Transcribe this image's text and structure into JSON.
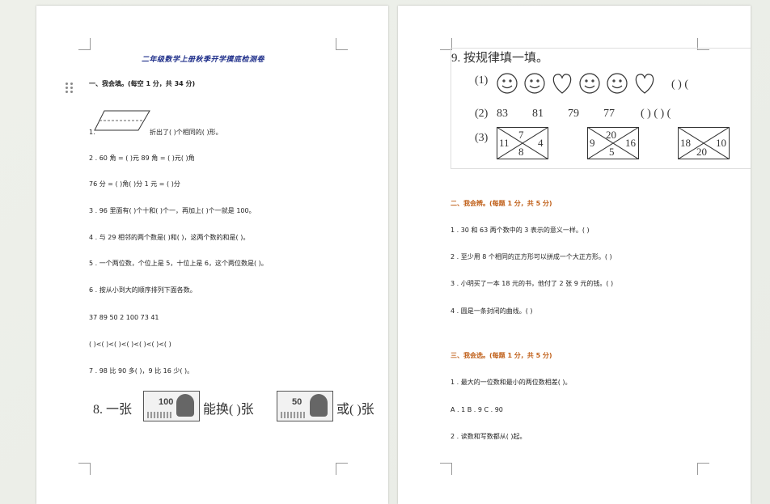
{
  "left_page": {
    "title": "二年级数学上册秋季开学摸底检测卷",
    "section1_title": "一、我会填。(每空  1  分，共  34  分)",
    "q1_num": "1.",
    "q1_text": "折出了(      )个相同的(      )形。",
    "q2_line1": "2 . 60  角 = (      )元    89  角 = (      )元(      )角",
    "q2_line2": "76  分 = (      )角(      )分    1  元 = (      )分",
    "q3": "3 . 96  里面有(      )个十和(      )个一，再加上(      )个一就是  100。",
    "q4": "4 . 与  29  相邻的两个数是(      )和(      )，这两个数的和是(      )。",
    "q5": "5 . 一个两位数，个位上是  5，十位上是  6，这个两位数是(      )。",
    "q6": "6 . 按从小到大的顺序排列下面各数。",
    "q6_numbers": "37 89 50 2 100 73 41",
    "q6_blanks": "(      )<(      )<(      )<(      )<(      )<(      )<(      )",
    "q7": "7 . 98  比  90  多(      )，9  比  16  少(      )。",
    "q8_prefix": "8.  一张",
    "q8_mid": "能换(      )张",
    "q8_suffix": "或(      )张",
    "note_100": "100",
    "note_50": "50"
  },
  "right_page": {
    "q9_title": "9.  按规律填一填。",
    "row1_label": "(1)",
    "row1_blanks": "(         )   (",
    "row2_label": "(2)",
    "row2_numbers": [
      "83",
      "81",
      "79",
      "77"
    ],
    "row2_blanks": "(         )   (         )   (",
    "row3_label": "(3)",
    "env1": {
      "top": "7",
      "left": "11",
      "right": "4",
      "bottom": "8"
    },
    "env2": {
      "top": "20",
      "left": "9",
      "right": "16",
      "bottom": "5"
    },
    "env3": {
      "top": "",
      "left": "18",
      "right": "10",
      "bottom": "20"
    },
    "section2_title": "二、我会辨。(每题  1  分，共  5  分)",
    "s2_q1": "1 . 30  和  63  两个数中的  3  表示的意义一样。(      )",
    "s2_q2": "2 . 至少用  8  个相同的正方形可以拼成一个大正方形。(      )",
    "s2_q3": "3 . 小明买了一本  18  元的书，他付了  2  张  9  元的钱。(      )",
    "s2_q4": "4 . 圆是一条封闭的曲线。(      )",
    "section3_title": "三、我会选。(每题  1  分，共  5  分)",
    "s3_q1": "1 . 最大的一位数和最小的两位数相差(      )。",
    "s3_q1_options": "A . 1   B . 9   C . 90",
    "s3_q2": "2 . 读数和写数都从(      )起。"
  },
  "colors": {
    "title": "#1f2f8a",
    "section_orange": "#c0601a",
    "page_bg": "#ffffff",
    "desk_bg": "#eef0ea"
  }
}
